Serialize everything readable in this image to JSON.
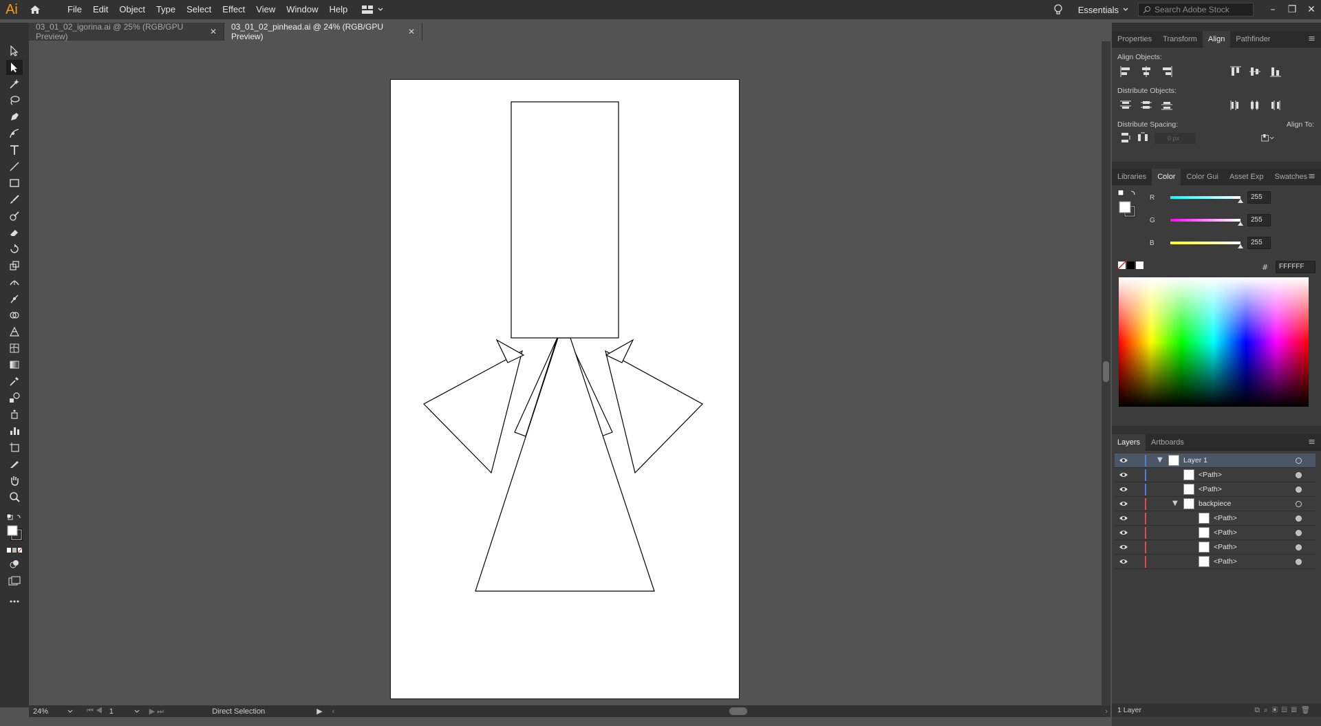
{
  "app": {
    "logo": "Ai",
    "home_icon": "home-icon"
  },
  "menu": [
    "File",
    "Edit",
    "Object",
    "Type",
    "Select",
    "Effect",
    "View",
    "Window",
    "Help"
  ],
  "workspace": {
    "label": "Essentials",
    "search_placeholder": "Search Adobe Stock"
  },
  "tabs": [
    {
      "label": "03_01_02_igorina.ai @ 25% (RGB/GPU Preview)",
      "active": false
    },
    {
      "label": "03_01_02_pinhead.ai @ 24% (RGB/GPU Preview)",
      "active": true
    }
  ],
  "status": {
    "zoom": "24%",
    "page": "1",
    "tool": "Direct Selection"
  },
  "align_panel": {
    "tabs": [
      "Properties",
      "Transform",
      "Align",
      "Pathfinder"
    ],
    "align_objects": "Align Objects:",
    "distribute_objects": "Distribute Objects:",
    "distribute_spacing": "Distribute Spacing:",
    "align_to": "Align To:",
    "spacing_value": "0 px"
  },
  "color_panel": {
    "tabs": [
      "Libraries",
      "Color",
      "Color Gui",
      "Asset Exp",
      "Swatches"
    ],
    "r_label": "R",
    "g_label": "G",
    "b_label": "B",
    "r": "255",
    "g": "255",
    "b": "255",
    "hash": "#",
    "hex": "FFFFFF"
  },
  "layers_panel": {
    "tabs": [
      "Layers",
      "Artboards"
    ],
    "rows": [
      {
        "name": "Layer 1"
      },
      {
        "name": "<Path>"
      },
      {
        "name": "<Path>"
      },
      {
        "name": "backpiece"
      },
      {
        "name": "<Path>"
      },
      {
        "name": "<Path>"
      },
      {
        "name": "<Path>"
      },
      {
        "name": "<Path>"
      }
    ],
    "footer": "1 Layer"
  },
  "colors": {
    "accent": "#ff9a00",
    "layer_blue": "#4f7fd9",
    "layer_red": "#d94f4f"
  }
}
